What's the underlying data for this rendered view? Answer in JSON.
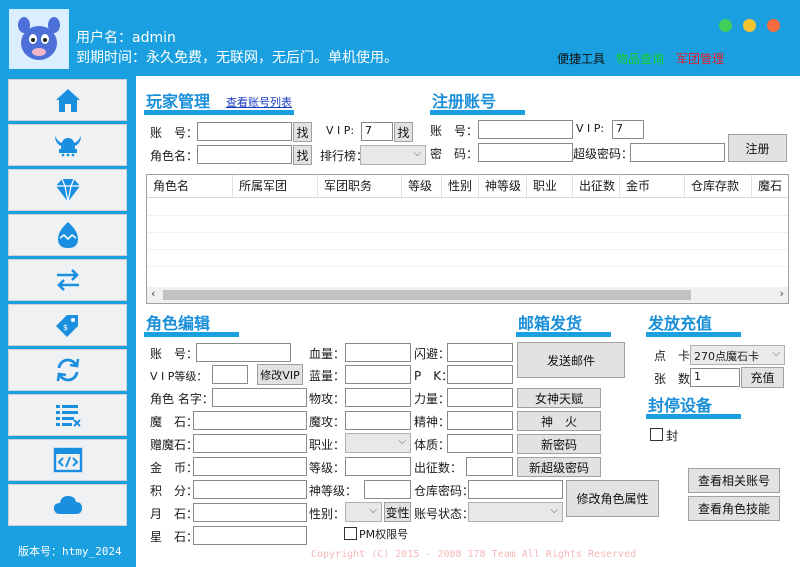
{
  "header": {
    "user_line": "用户名：admin",
    "expiry_line": "到期时间：永久免费，无联网，无后门。单机使用。",
    "links": [
      "便捷工具",
      "物品查询",
      "军团管理"
    ]
  },
  "sidebar": {
    "items": [
      "home-icon",
      "viking-helmet-icon",
      "diamond-icon",
      "egg-icon",
      "swap-arrows-icon",
      "tag-icon",
      "refresh-icon",
      "list-icon",
      "code-window-icon",
      "cloud-icon"
    ],
    "version": "版本号：htmy_2024"
  },
  "player": {
    "title": "玩家管理",
    "view_list_link": "查看账号列表",
    "account_label": "账　号：",
    "find": "找",
    "vip_label": "V I P:",
    "vip_value": "7",
    "find2": "找",
    "role_label": "角色名：",
    "rank_label": "排行榜："
  },
  "register": {
    "title": "注册账号",
    "account_label": "账　号：",
    "vip_label": "V I P:",
    "vip_value": "7",
    "password_label": "密　码：",
    "super_pwd_label": "超级密码：",
    "register_button": "注册"
  },
  "table": {
    "columns": [
      "角色名",
      "所属军团",
      "军团职务",
      "等级",
      "性别",
      "神等级",
      "职业",
      "出征数",
      "金币",
      "仓库存款",
      "魔石"
    ]
  },
  "role_edit": {
    "title": "角色编辑",
    "fields_left": [
      "账　号：",
      "V I P等级：",
      "角色 名字：",
      "魔　石：",
      "赠魔石：",
      "金　币：",
      "积　分：",
      "月　石：",
      "星　石："
    ],
    "modify_vip": "修改VIP",
    "fields_mid": [
      "血量：",
      "蓝量：",
      "物攻：",
      "魔攻：",
      "职业：",
      "等级：",
      "神等级：",
      "性别："
    ],
    "change_gender": "变性",
    "pm_permission": "PM权限号",
    "fields_right": [
      "闪避：",
      "P　K：",
      "力量：",
      "精神：",
      "体质：",
      "出征数：",
      "仓库密码：",
      "账号状态："
    ],
    "buttons": [
      "女神天赋",
      "神　火",
      "新密码",
      "新超级密码",
      "修改角色属性"
    ]
  },
  "mail": {
    "title": "邮箱发货",
    "send_button": "发送邮件"
  },
  "recharge": {
    "title": "发放充值",
    "card_label": "点　卡：",
    "card_value": "270点魔石卡",
    "count_label": "张　数：",
    "count_value": "1",
    "recharge_button": "充值"
  },
  "ban": {
    "title": "封停设备",
    "ban_label": "封",
    "view_accounts": "查看相关账号",
    "view_skills": "查看角色技能"
  },
  "footer": {
    "copyright": "Copyright (C) 2015 - 2088 178 Team All Rights Reserved"
  }
}
